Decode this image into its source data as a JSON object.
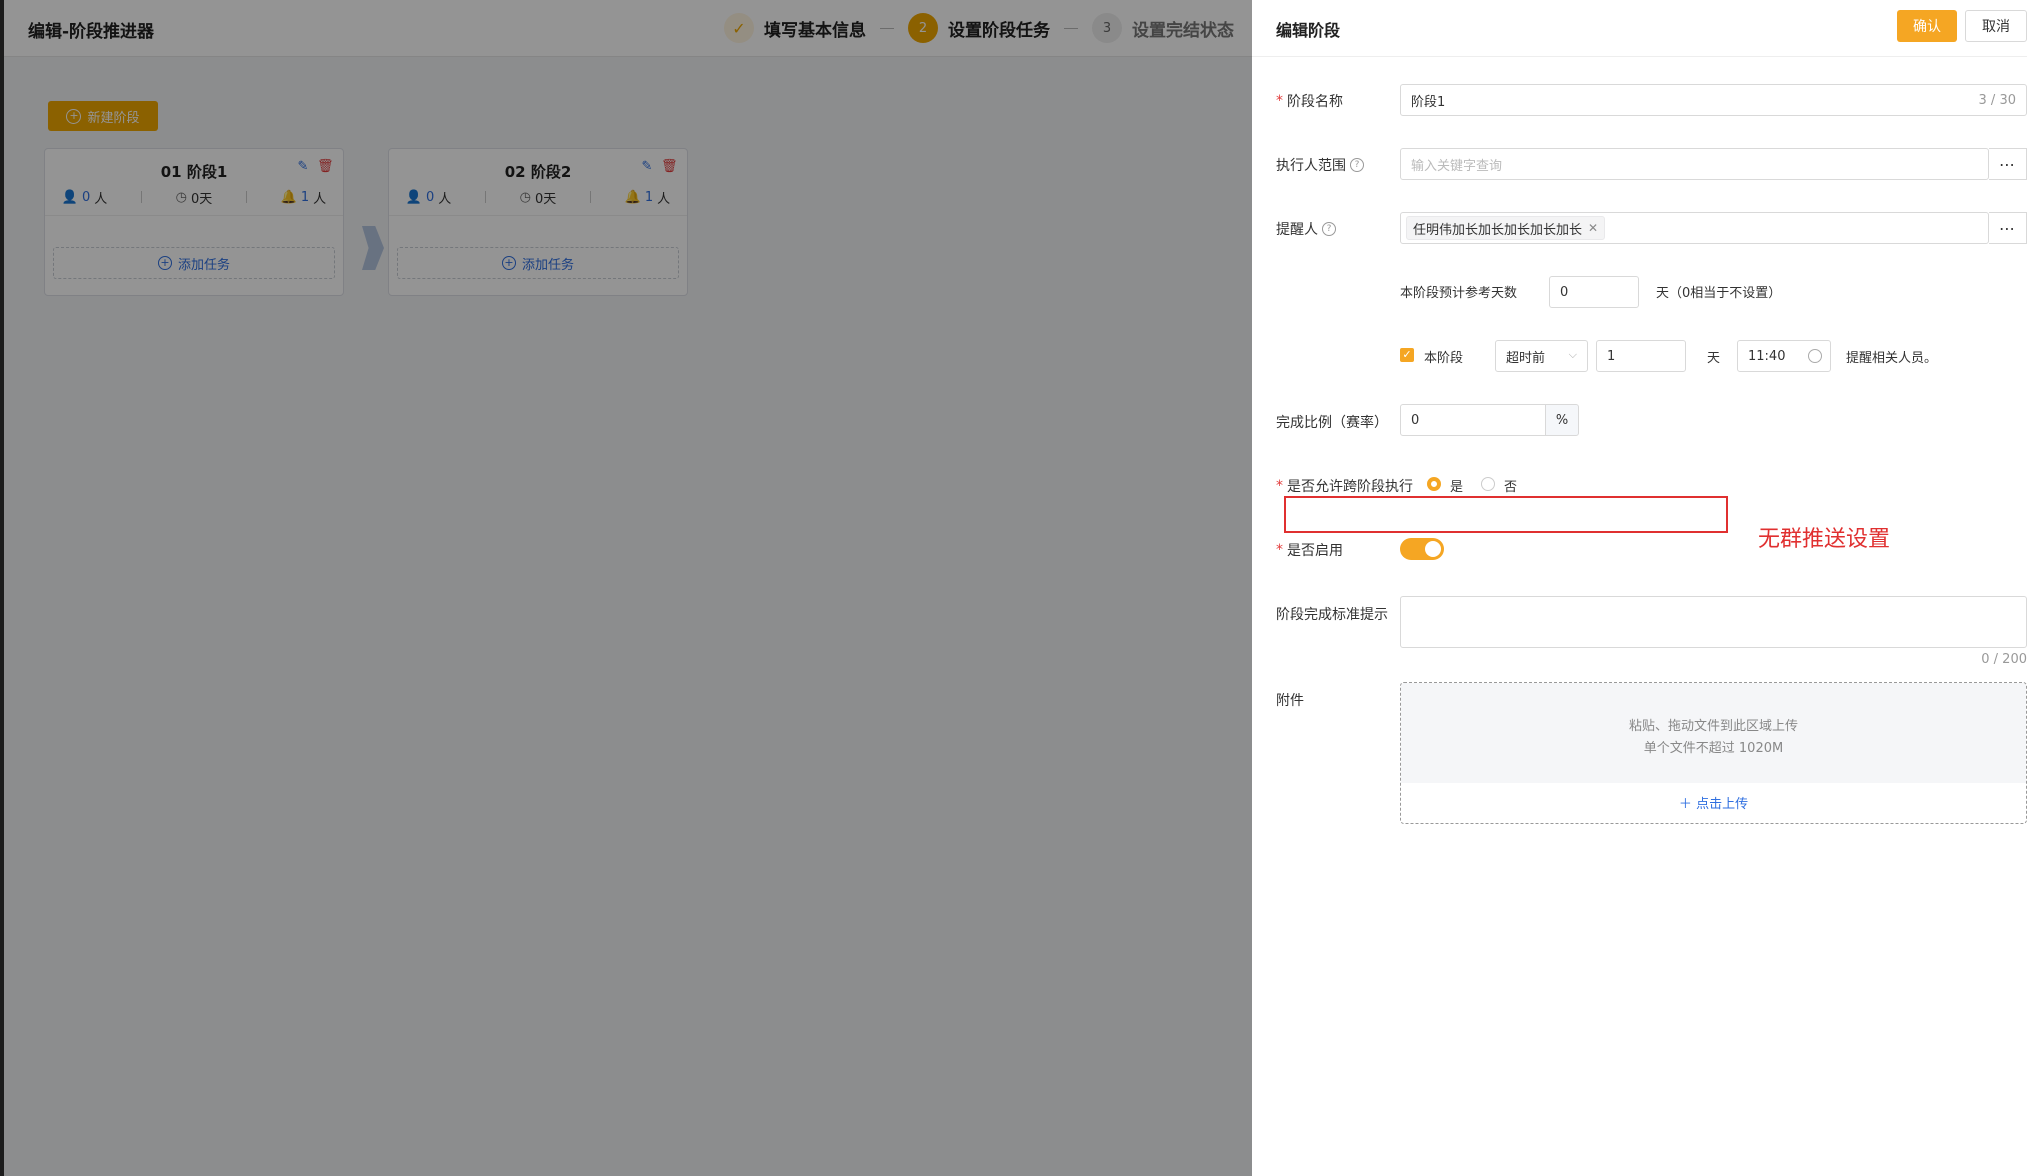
{
  "page": {
    "title": "编辑-阶段推进器",
    "steps": [
      {
        "label": "填写基本信息",
        "marker": "✓",
        "state": "done"
      },
      {
        "label": "设置阶段任务",
        "marker": "2",
        "state": "active"
      },
      {
        "label": "设置完结状态",
        "marker": "3",
        "state": "todo"
      }
    ],
    "new_stage_label": "新建阶段",
    "stages": [
      {
        "title": "01 阶段1",
        "people": "0",
        "people_unit": "人",
        "days": "0天",
        "reminders": "1",
        "reminders_unit": "人",
        "add_task_label": "添加任务"
      },
      {
        "title": "02 阶段2",
        "people": "0",
        "people_unit": "人",
        "days": "0天",
        "reminders": "1",
        "reminders_unit": "人",
        "add_task_label": "添加任务"
      }
    ]
  },
  "drawer": {
    "title": "编辑阶段",
    "confirm_label": "确认",
    "cancel_label": "取消",
    "fields": {
      "stage_name": {
        "label": "阶段名称",
        "value": "阶段1",
        "counter": "3 / 30"
      },
      "executor_scope": {
        "label": "执行人范围",
        "placeholder": "输入关键字查询"
      },
      "reminder": {
        "label": "提醒人",
        "tag": "任明伟加长加长加长加长加长"
      },
      "ref_days": {
        "label": "本阶段预计参考天数",
        "value": "0",
        "suffix": "天（0相当于不设置）"
      },
      "timeout": {
        "check_label": "本阶段",
        "mode": "超时前",
        "amount": "1",
        "unit": "天",
        "time": "11:40",
        "suffix": "提醒相关人员。"
      },
      "completion_ratio": {
        "label": "完成比例（赛率）",
        "value": "0",
        "unit": "%"
      },
      "cross_stage": {
        "label": "是否允许跨阶段执行",
        "yes": "是",
        "no": "否"
      },
      "enabled": {
        "label": "是否启用"
      },
      "criteria_hint": {
        "label": "阶段完成标准提示",
        "counter": "0 / 200"
      },
      "attachment": {
        "label": "附件",
        "drop_line1": "粘贴、拖动文件到此区域上传",
        "drop_line2": "单个文件不超过 1020M",
        "upload_label": "点击上传"
      }
    },
    "annotation": "无群推送设置"
  },
  "colors": {
    "accent": "#f5a623",
    "link": "#2f6fe0",
    "annotation": "#e03030"
  }
}
